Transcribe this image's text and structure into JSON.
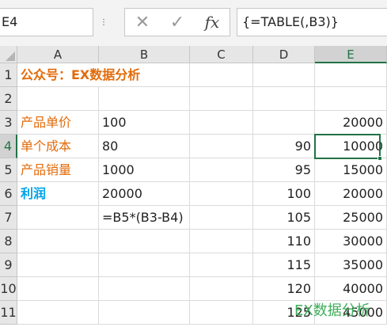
{
  "name_box": "E4",
  "formula": "{=TABLE(,B3)}",
  "columns": [
    "A",
    "B",
    "C",
    "D",
    "E"
  ],
  "rows": [
    "1",
    "2",
    "3",
    "4",
    "5",
    "6",
    "7",
    "8",
    "9",
    "10",
    "11"
  ],
  "cells": {
    "A1": "公众号：EX数据分析",
    "A3": "产品单价",
    "B3": "100",
    "E3": "20000",
    "A4": "单个成本",
    "B4": "80",
    "D4": "90",
    "E4": "10000",
    "A5": "产品销量",
    "B5": "1000",
    "D5": "95",
    "E5": "15000",
    "A6": "利润",
    "B6": "20000",
    "D6": "100",
    "E6": "20000",
    "B7": "=B5*(B3-B4)",
    "D7": "105",
    "E7": "25000",
    "D8": "110",
    "E8": "30000",
    "D9": "115",
    "E9": "35000",
    "D10": "120",
    "E10": "40000",
    "D11": "125",
    "E11": "45000"
  },
  "watermark": "EX数据分析",
  "colors": {
    "accent": "#217346",
    "label_orange": "#e26b0a",
    "profit_blue": "#00a2e8"
  }
}
